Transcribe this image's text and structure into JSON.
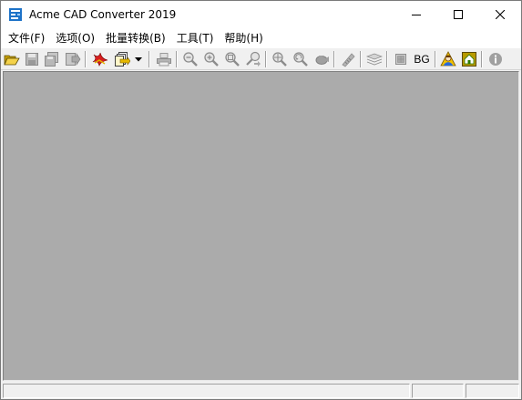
{
  "window": {
    "title": "Acme CAD Converter 2019",
    "app_icon": "acme-cad-converter-icon"
  },
  "menu": [
    {
      "label": "文件(F)"
    },
    {
      "label": "选项(O)"
    },
    {
      "label": "批量转换(B)"
    },
    {
      "label": "工具(T)"
    },
    {
      "label": "帮助(H)"
    }
  ],
  "toolbar": {
    "buttons": [
      {
        "icon": "open-folder-icon",
        "enabled": true
      },
      {
        "icon": "save-icon",
        "enabled": false
      },
      {
        "icon": "save-all-icon",
        "enabled": false
      },
      {
        "icon": "export-icon",
        "enabled": false
      },
      {
        "icon": "convert-pdf-icon",
        "enabled": true
      },
      {
        "icon": "batch-convert-icon",
        "enabled": true
      },
      {
        "icon": "dropdown-arrow-icon",
        "enabled": true
      },
      {
        "icon": "print-icon",
        "enabled": false
      },
      {
        "icon": "zoom-out-icon",
        "enabled": false
      },
      {
        "icon": "zoom-in-icon",
        "enabled": false
      },
      {
        "icon": "zoom-window-icon",
        "enabled": false
      },
      {
        "icon": "zoom-realtime-icon",
        "enabled": false
      },
      {
        "icon": "zoom-extents-icon",
        "enabled": false
      },
      {
        "icon": "zoom-previous-icon",
        "enabled": false
      },
      {
        "icon": "pan-icon",
        "enabled": false
      },
      {
        "icon": "measure-icon",
        "enabled": false
      },
      {
        "icon": "layers-icon",
        "enabled": false
      },
      {
        "icon": "background-color-icon",
        "enabled": false
      },
      {
        "icon": "bg-toggle",
        "enabled": true
      },
      {
        "icon": "user-guide-icon",
        "enabled": true
      },
      {
        "icon": "home-icon",
        "enabled": true
      },
      {
        "icon": "about-icon",
        "enabled": false
      }
    ],
    "bg_label": "BG"
  },
  "colors": {
    "workspace": "#ababab",
    "chrome": "#f0f0f0",
    "titlebar": "#ffffff",
    "disabled_icon": "#a0a0a0"
  }
}
